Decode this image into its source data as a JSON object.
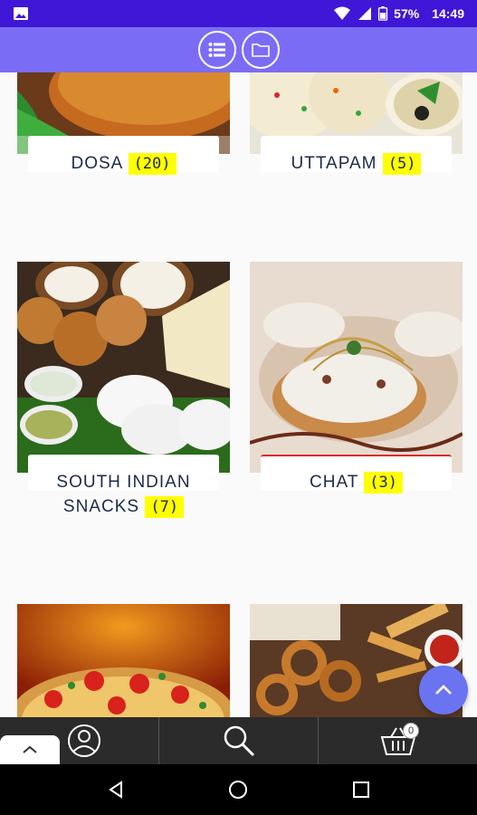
{
  "status_bar": {
    "battery": "57%",
    "time": "14:49"
  },
  "toolbar": {
    "list_icon": "list-icon",
    "folder_icon": "folder-icon"
  },
  "categories": [
    {
      "name": "DOSA",
      "count": "(20)"
    },
    {
      "name": "UTTAPAM",
      "count": "(5)"
    },
    {
      "name_line1": "SOUTH INDIAN",
      "name_line2": "SNACKS",
      "count": "(7)"
    },
    {
      "name": "CHAT",
      "count": "(3)"
    }
  ],
  "bottom_nav": {
    "cart_count": "0"
  },
  "colors": {
    "status_bar": "#3f17d6",
    "toolbar": "#7b6cf6",
    "count_highlight": "#ffff00",
    "fab": "#6a74f0",
    "bottom_nav": "#2b2b2b"
  }
}
